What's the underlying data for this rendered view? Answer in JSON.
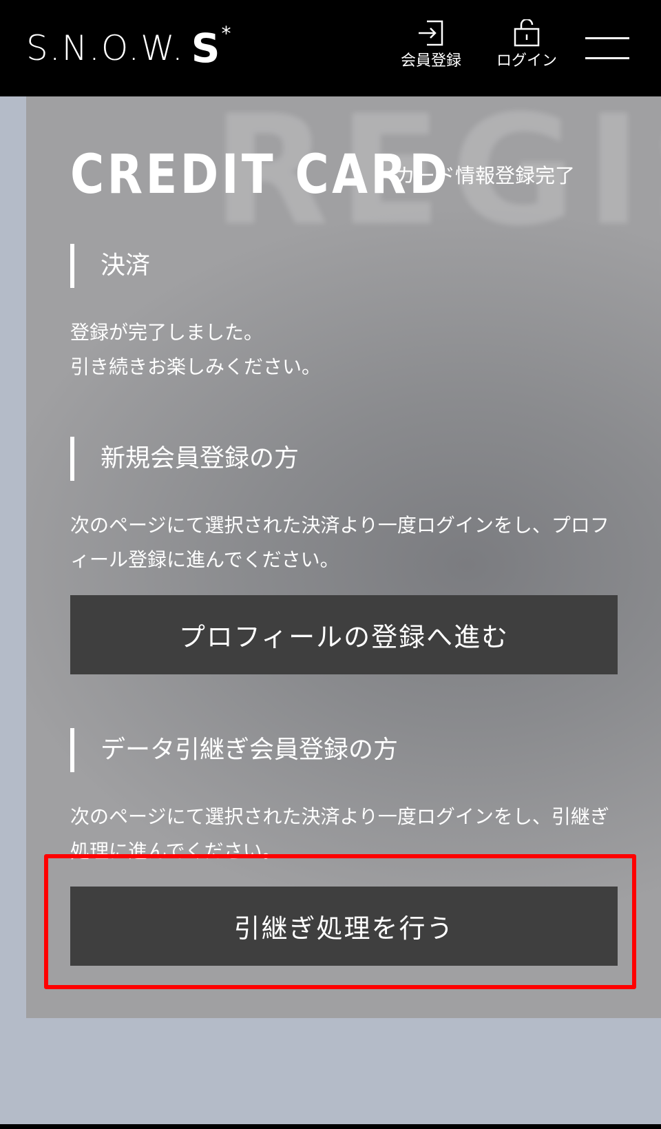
{
  "header": {
    "logo_base": "S.N.O.W.",
    "logo_s": "S",
    "logo_star": "*",
    "register_label": "会員登録",
    "register_icon": "sign-in-icon",
    "login_label": "ログイン",
    "login_icon": "lock-icon",
    "menu_icon": "hamburger-menu-icon"
  },
  "page": {
    "bg_word": "REGIST",
    "title": "CREDIT CARD",
    "subtitle": "カード情報登録完了"
  },
  "sections": [
    {
      "heading": "決済",
      "body_line1": "登録が完了しました。",
      "body_line2": "引き続きお楽しみください。"
    },
    {
      "heading": "新規会員登録の方",
      "body": "次のページにて選択された決済より一度ログインをし、プロフィール登録に進んでください。",
      "button": "プロフィールの登録へ進む"
    },
    {
      "heading": "データ引継ぎ会員登録の方",
      "body": "次のページにて選択された決済より一度ログインをし、引継ぎ処理に進んでください。",
      "button": "引継ぎ処理を行う"
    }
  ],
  "colors": {
    "header_bg": "#000000",
    "button_bg": "#3f3f3f",
    "highlight": "#ff0000",
    "page_bg": "#b4bbc8"
  }
}
